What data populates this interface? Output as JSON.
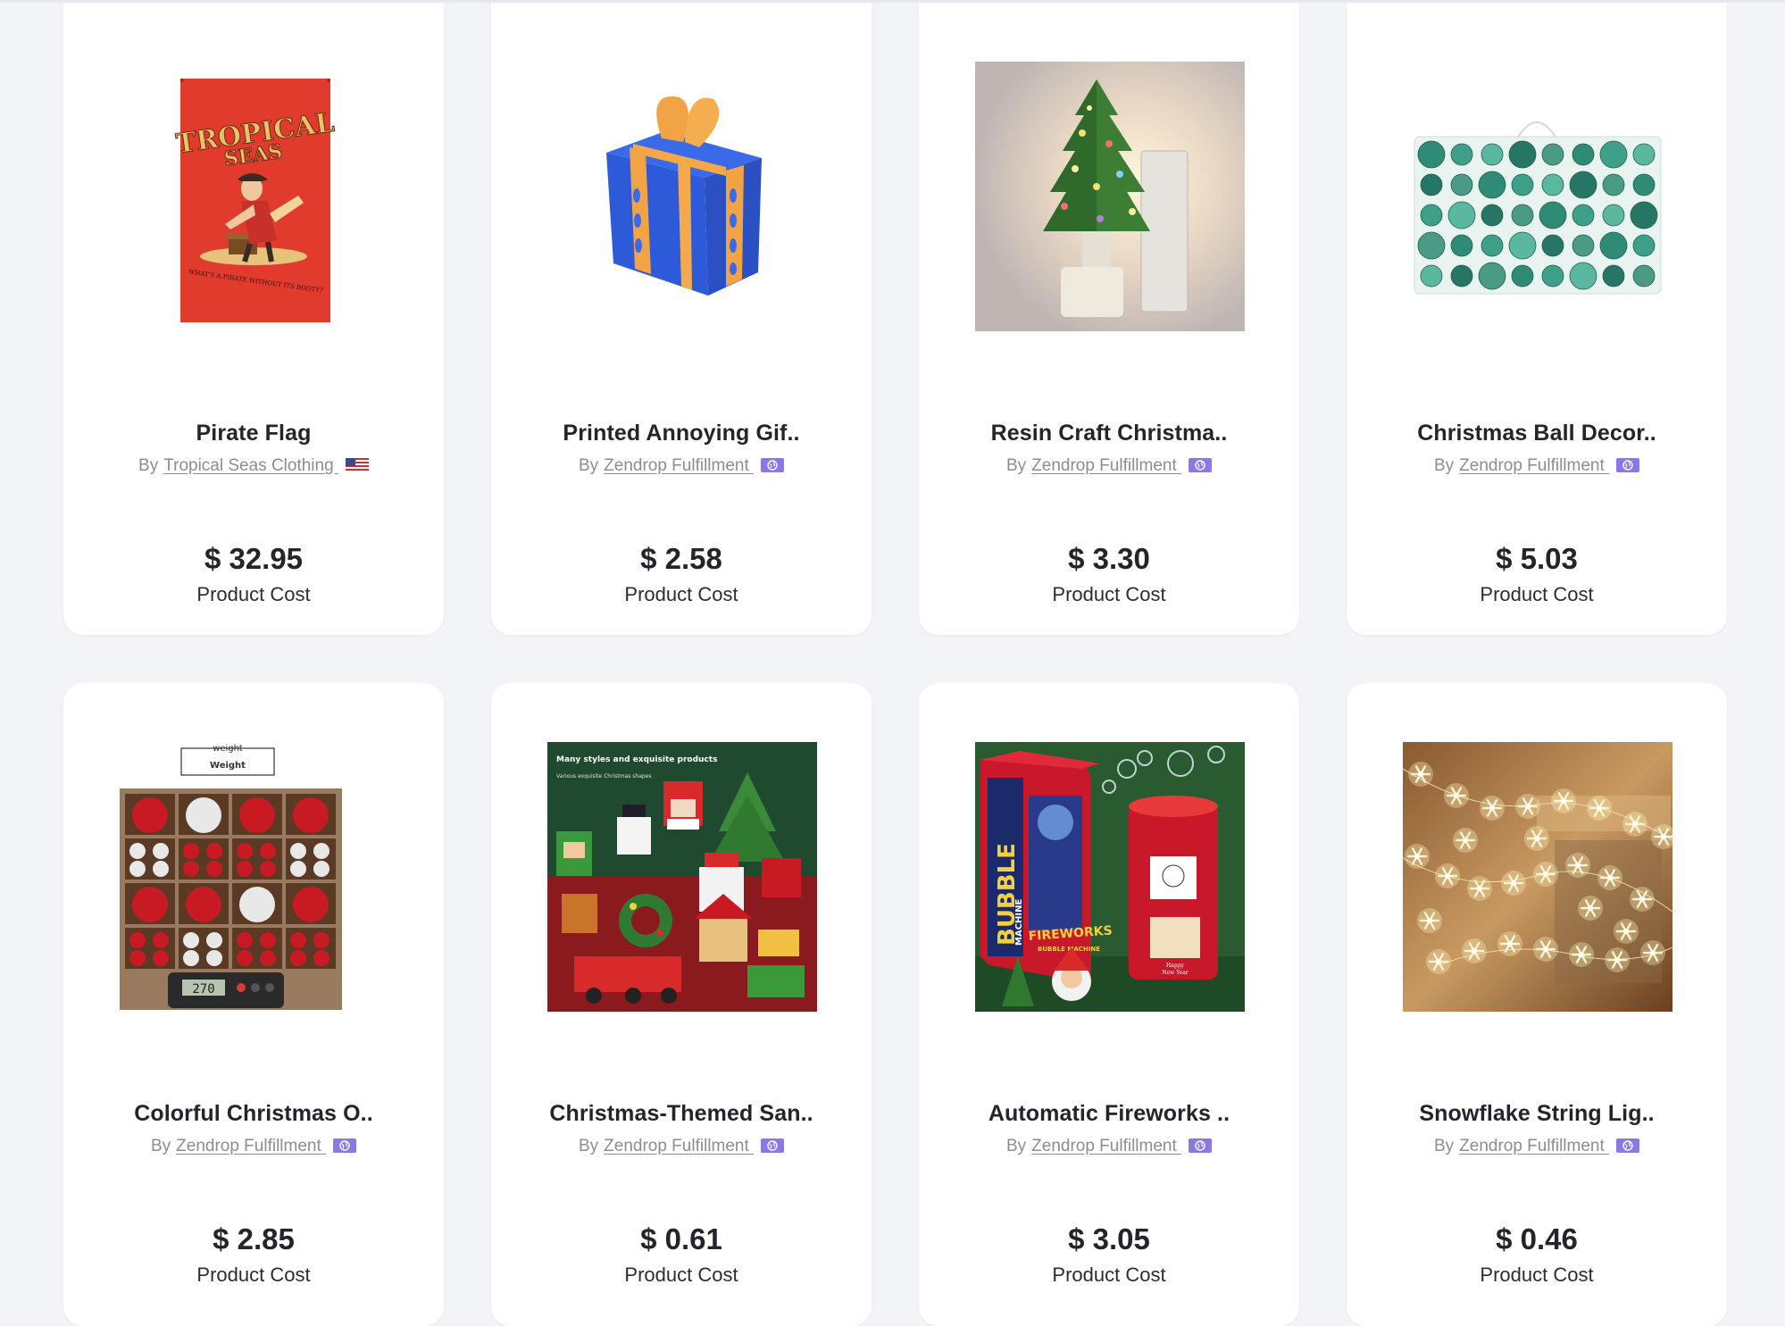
{
  "products": [
    {
      "title": "Pirate Flag",
      "by_label": "By",
      "vendor": "Tropical Seas Clothing ",
      "flag_icon": "us-flag-icon",
      "price": "$ 32.95",
      "cost_label": "Product Cost",
      "image_text": {
        "line1": "TROPICAL",
        "line2": "SEAS",
        "tagline": "WHAT'S A PIRATE WITHOUT ITS BOOTY?"
      }
    },
    {
      "title": "Printed Annoying Gif..",
      "by_label": "By",
      "vendor": "Zendrop Fulfillment ",
      "flag_icon": "globe-icon",
      "price": "$ 2.58",
      "cost_label": "Product Cost"
    },
    {
      "title": "Resin Craft Christma..",
      "by_label": "By",
      "vendor": "Zendrop Fulfillment ",
      "flag_icon": "globe-icon",
      "price": "$ 3.30",
      "cost_label": "Product Cost"
    },
    {
      "title": "Christmas Ball Decor..",
      "by_label": "By",
      "vendor": "Zendrop Fulfillment ",
      "flag_icon": "globe-icon",
      "price": "$ 5.03",
      "cost_label": "Product Cost"
    },
    {
      "title": "Colorful Christmas O..",
      "by_label": "By",
      "vendor": "Zendrop Fulfillment ",
      "flag_icon": "globe-icon",
      "price": "$ 2.85",
      "cost_label": "Product Cost",
      "image_text": {
        "weight_top": "weight",
        "weight_bottom": "Weight",
        "scale": "270"
      }
    },
    {
      "title": "Christmas-Themed San..",
      "by_label": "By",
      "vendor": "Zendrop Fulfillment ",
      "flag_icon": "globe-icon",
      "price": "$ 0.61",
      "cost_label": "Product Cost",
      "image_text": {
        "headline": "Many styles and exquisite products",
        "sub": "Various exquisite Christmas shapes"
      }
    },
    {
      "title": "Automatic Fireworks ..",
      "by_label": "By",
      "vendor": "Zendrop Fulfillment ",
      "flag_icon": "globe-icon",
      "price": "$ 3.05",
      "cost_label": "Product Cost",
      "image_text": {
        "bubble": "BUBBLE",
        "machine": "MACHINE",
        "fireworks": "FIREWORKS",
        "fw_sub": "BUBBLE MACHINE",
        "happy": "Happy",
        "newyear": "New Year"
      }
    },
    {
      "title": "Snowflake String Lig..",
      "by_label": "By",
      "vendor": "Zendrop Fulfillment ",
      "flag_icon": "globe-icon",
      "price": "$ 0.46",
      "cost_label": "Product Cost"
    }
  ],
  "colors": {
    "page_bg": "#f3f4f7",
    "card_bg": "#ffffff",
    "title_text": "#24252b",
    "muted_text": "#8a8d96",
    "globe_badge": "#8b78e6"
  }
}
